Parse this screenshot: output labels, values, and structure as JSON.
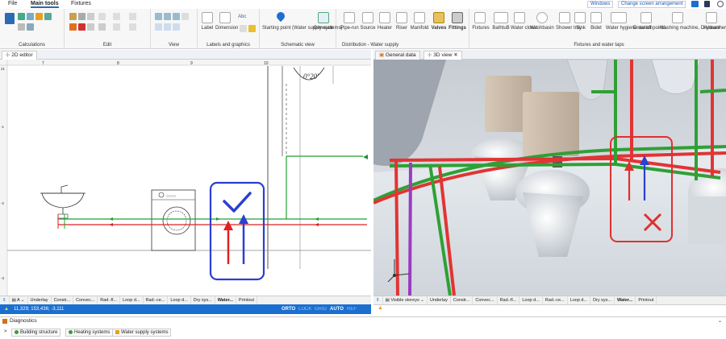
{
  "menu": {
    "file": "File",
    "main_tools": "Main tools",
    "fixtures": "Fixtures",
    "windows": "Windows",
    "screen_arrangement": "Change screen arrangement"
  },
  "ribbon": {
    "groups": {
      "calculations": "Calculations",
      "edit": "Edit",
      "view": "View",
      "labels": "Labels and graphics",
      "schematic": "Schematic view",
      "distribution": "Distribution - Water supply",
      "fixtures_taps": "Fixtures and water taps"
    },
    "buttons": {
      "label": "Label",
      "dimension": "Dimension line",
      "abc": "Abc",
      "starting_point": "Starting point (Water supply systems)",
      "generate": "Generate",
      "pipe_run": "Pipe-run",
      "source": "Source",
      "heater": "Heater",
      "riser": "Riser",
      "manifold": "Manifold",
      "valves": "Valves",
      "fittings": "Fittings",
      "fixtures": "Fixtures",
      "bathtub": "BathtuB",
      "water_closet": "Water closet",
      "washbasin": "Washbasin",
      "shower_tray": "Shower tray",
      "sink": "Sink",
      "bidet": "Bidet",
      "water_hygiene": "Water hygiene station",
      "draw_off": "Draw-off points",
      "washing_machine": "Washing machine, Dishwasher",
      "hydrant": "Hydrant"
    }
  },
  "editor": {
    "tab": "2D editor",
    "ruler_top": [
      "7",
      "8",
      "9",
      "10"
    ],
    "ruler_left": [
      "21",
      "-1",
      "-2",
      "-3"
    ]
  },
  "view3d": {
    "tabs": [
      "General data",
      "3D view"
    ],
    "active": "3D view"
  },
  "layers_left": {
    "layer": "A",
    "items": [
      "Underlay",
      "Constr...",
      "Convec...",
      "Rad.-fl...",
      "Loop d...",
      "Rad.-ce...",
      "Loop d...",
      "Dry sys...",
      "Water...",
      "Printout"
    ]
  },
  "layers_right": {
    "visible": "Visible storeys",
    "items": [
      "Underlay",
      "Constr...",
      "Convec...",
      "Rad.-fl...",
      "Loop d...",
      "Rad.-ce...",
      "Loop d...",
      "Dry sys...",
      "Water...",
      "Printout"
    ]
  },
  "status": {
    "coords": "11,329; 153,436; -3,111",
    "modes": [
      "ORTO",
      "LOCK",
      "GRID",
      "AUTO",
      "REF"
    ]
  },
  "diagnostics": {
    "title": "Diagnostics",
    "tabs": [
      "Building structure",
      "Heating systems",
      "Water supply systems"
    ]
  },
  "colors": {
    "accent": "#1a6fd1",
    "red_pipe": "#e02020",
    "green_pipe": "#22a030",
    "blue_box": "#2b3fd0",
    "check": "#2b3fd0",
    "cross": "#e03030"
  }
}
